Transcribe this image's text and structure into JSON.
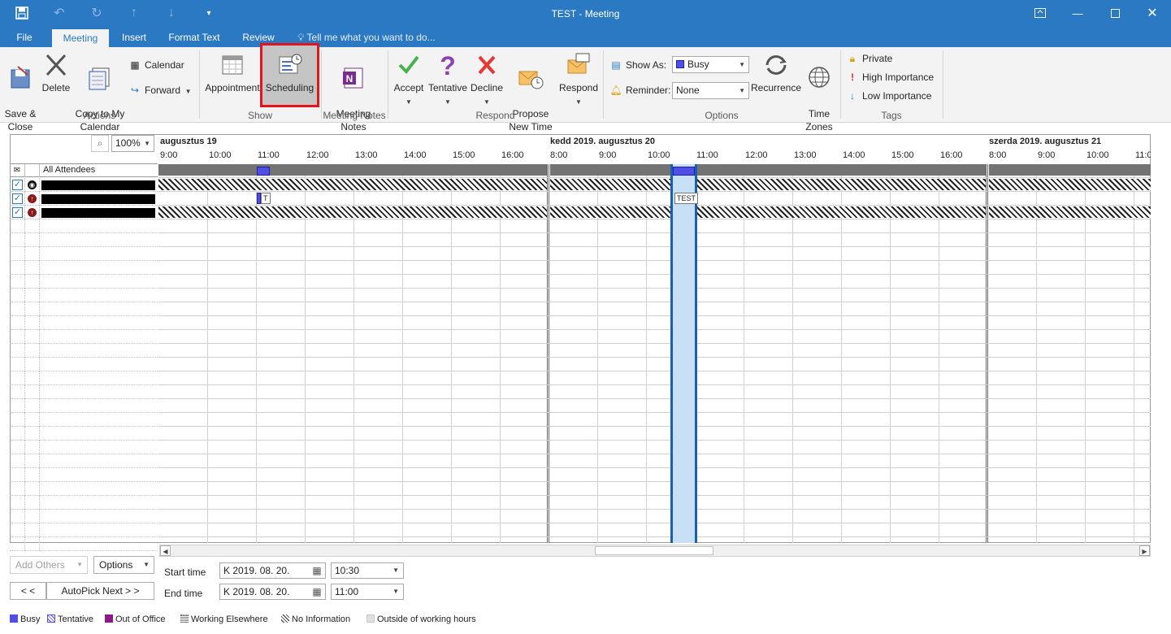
{
  "window": {
    "title": "TEST - Meeting"
  },
  "tabs": [
    {
      "label": "File"
    },
    {
      "label": "Meeting"
    },
    {
      "label": "Insert"
    },
    {
      "label": "Format Text"
    },
    {
      "label": "Review"
    }
  ],
  "tellme": {
    "text": "Tell me what you want to do..."
  },
  "ribbon": {
    "actions": {
      "group_label": "Actions",
      "save_close": "Save &\nClose",
      "delete": "Delete",
      "copy_calendar": "Copy to My\nCalendar",
      "calendar": "Calendar",
      "forward": "Forward"
    },
    "show": {
      "group_label": "Show",
      "appointment": "Appointment",
      "scheduling": "Scheduling"
    },
    "meeting_notes": {
      "group_label": "Meeting Notes",
      "button": "Meeting\nNotes"
    },
    "respond": {
      "group_label": "Respond",
      "accept": "Accept",
      "tentative": "Tentative",
      "decline": "Decline",
      "propose": "Propose\nNew Time",
      "respond": "Respond"
    },
    "options": {
      "group_label": "Options",
      "show_as_label": "Show As:",
      "show_as_value": "Busy",
      "reminder_label": "Reminder:",
      "reminder_value": "None",
      "recurrence": "Recurrence",
      "time_zones": "Time\nZones"
    },
    "tags": {
      "group_label": "Tags",
      "private": "Private",
      "high": "High Importance",
      "low": "Low Importance"
    }
  },
  "scheduler": {
    "zoom": "100%",
    "days": [
      {
        "label": "augusztus 19",
        "hours": [
          "9:00",
          "10:00",
          "11:00",
          "12:00",
          "13:00",
          "14:00",
          "15:00",
          "16:00"
        ]
      },
      {
        "label": "kedd 2019. augusztus 20",
        "hours": [
          "8:00",
          "9:00",
          "10:00",
          "11:00",
          "12:00",
          "13:00",
          "14:00",
          "15:00",
          "16:00"
        ]
      },
      {
        "label": "szerda 2019. augusztus 21",
        "hours": [
          "8:00",
          "9:00",
          "10:00",
          "11:0"
        ]
      }
    ],
    "all_attendees": "All Attendees",
    "busy_label_1": "T",
    "busy_label_2": "TEST"
  },
  "controls": {
    "add_others": "Add Others",
    "options": "Options",
    "prev": "< <",
    "autopick": "AutoPick Next > >",
    "start_label": "Start time",
    "start_date": "K 2019. 08. 20.",
    "start_time": "10:30",
    "end_label": "End time",
    "end_date": "K 2019. 08. 20.",
    "end_time": "11:00"
  },
  "legend": {
    "busy": "Busy",
    "tentative": "Tentative",
    "out_of_office": "Out of Office",
    "working_elsewhere": "Working Elsewhere",
    "no_info": "No Information",
    "outside_hours": "Outside of working hours"
  },
  "colors": {
    "accent": "#2b79c3",
    "busy": "#4f4fe8",
    "out_of_office": "#8b1a8b",
    "selection": "#c8e0f5"
  }
}
